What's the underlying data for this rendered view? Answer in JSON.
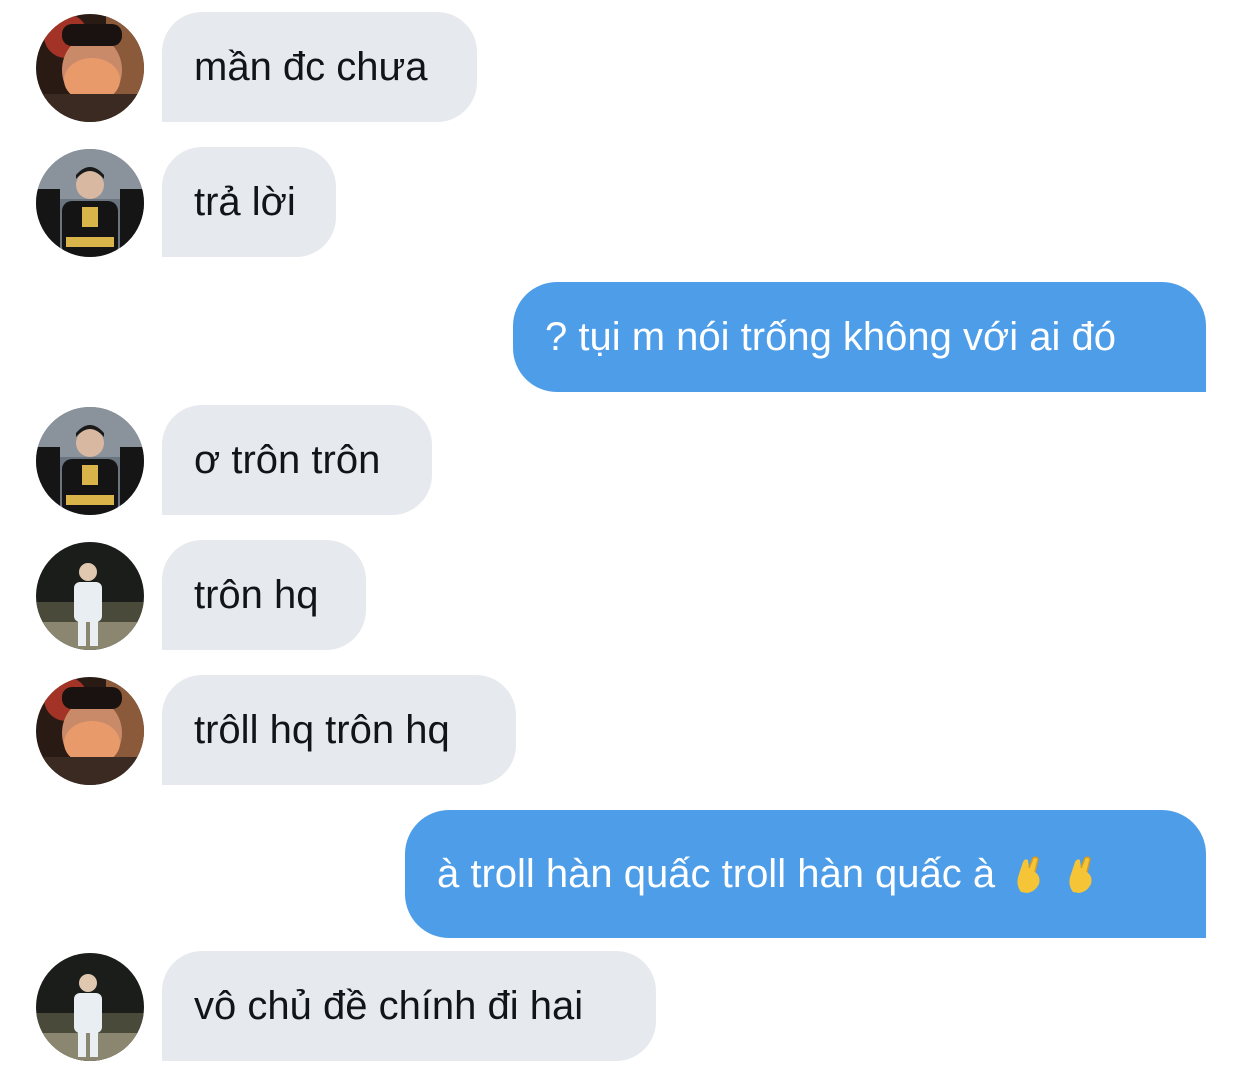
{
  "messages": [
    {
      "sender": "other",
      "avatar": "avatar-orange-mask",
      "text": "mần đc chưa"
    },
    {
      "sender": "other",
      "avatar": "avatar-fearx-team",
      "text": "trả lời"
    },
    {
      "sender": "me",
      "text": "? tụi m nói trống không với ai đó"
    },
    {
      "sender": "other",
      "avatar": "avatar-fearx-team",
      "text": "ơ trôn trôn"
    },
    {
      "sender": "other",
      "avatar": "avatar-night-photo",
      "text": "trôn hq"
    },
    {
      "sender": "other",
      "avatar": "avatar-orange-mask",
      "text": "trôll hq trôn hq"
    },
    {
      "sender": "me",
      "text": "à troll hàn quấc troll hàn quấc à",
      "emojis": [
        "pinched-fingers-emoji",
        "pinched-fingers-emoji"
      ]
    },
    {
      "sender": "other",
      "avatar": "avatar-night-photo",
      "text": "vô chủ đề chính đi hai"
    }
  ],
  "colors": {
    "incoming_bubble": "#e6e9ed",
    "outgoing_bubble": "#4d9de8",
    "incoming_text": "#111418",
    "outgoing_text": "#ffffff"
  }
}
